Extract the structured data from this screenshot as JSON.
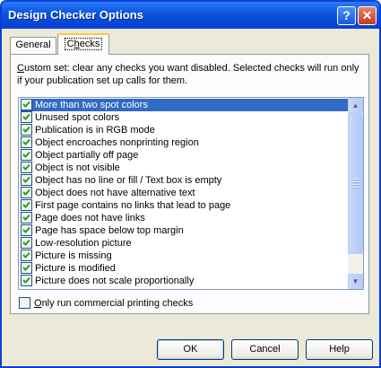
{
  "window": {
    "title": "Design Checker Options"
  },
  "titlebar_icons": {
    "help": "?",
    "close": "✕"
  },
  "tabs": [
    {
      "label": "General",
      "selected": false
    },
    {
      "label": "Checks",
      "selected": true
    }
  ],
  "description": "Custom set: clear any checks you want disabled. Selected checks will run only if your publication set up calls for them.",
  "checks": [
    {
      "label": "More than two spot colors",
      "checked": true,
      "selected": true
    },
    {
      "label": "Unused spot colors",
      "checked": true,
      "selected": false
    },
    {
      "label": "Publication is in RGB mode",
      "checked": true,
      "selected": false
    },
    {
      "label": "Object encroaches nonprinting region",
      "checked": true,
      "selected": false
    },
    {
      "label": "Object partially off page",
      "checked": true,
      "selected": false
    },
    {
      "label": "Object is not visible",
      "checked": true,
      "selected": false
    },
    {
      "label": "Object has no line or fill / Text box is empty",
      "checked": true,
      "selected": false
    },
    {
      "label": "Object does not have alternative text",
      "checked": true,
      "selected": false
    },
    {
      "label": "First page contains no links that lead to page",
      "checked": true,
      "selected": false
    },
    {
      "label": "Page does not have links",
      "checked": true,
      "selected": false
    },
    {
      "label": "Page has space below top margin",
      "checked": true,
      "selected": false
    },
    {
      "label": "Low-resolution picture",
      "checked": true,
      "selected": false
    },
    {
      "label": "Picture is missing",
      "checked": true,
      "selected": false
    },
    {
      "label": "Picture is modified",
      "checked": true,
      "selected": false
    },
    {
      "label": "Picture does not scale proportionally",
      "checked": true,
      "selected": false
    }
  ],
  "commercial_checkbox": {
    "label": "Only run commercial printing checks",
    "checked": false
  },
  "buttons": {
    "ok": "OK",
    "cancel": "Cancel",
    "help": "Help"
  },
  "colors": {
    "title_bar": "#0a58e3",
    "selection": "#316ac5",
    "checkmark": "#21a121",
    "dialog_bg": "#ece9d8"
  }
}
